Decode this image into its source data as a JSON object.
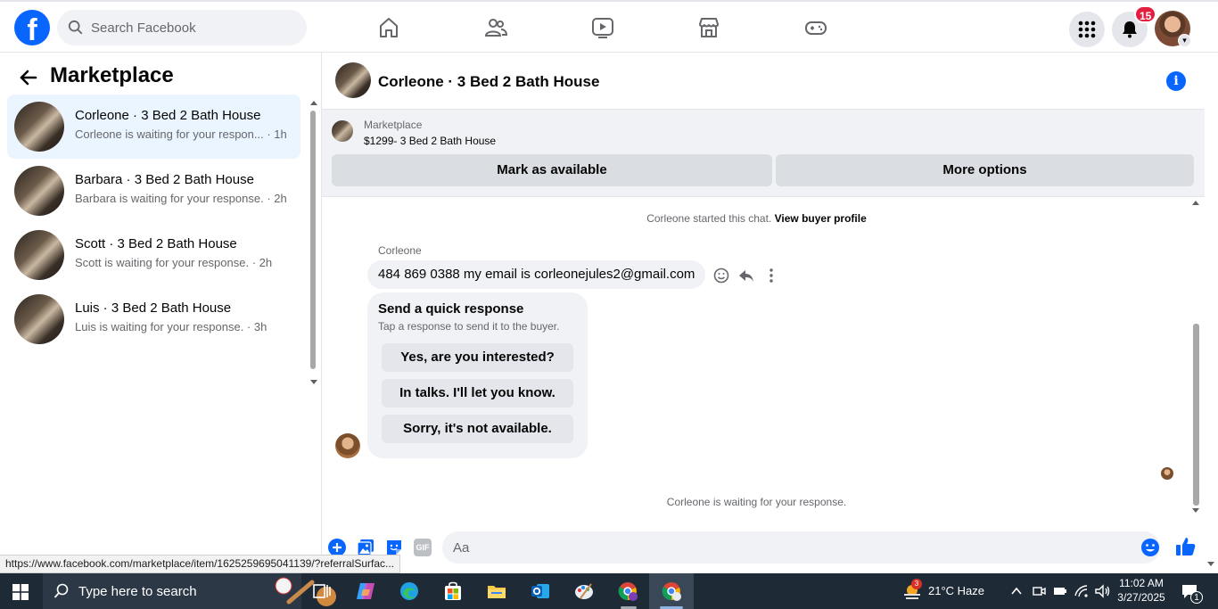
{
  "topbar": {
    "search_placeholder": "Search Facebook",
    "notifications_count": "15"
  },
  "sidebar": {
    "title": "Marketplace",
    "conversations": [
      {
        "title": "Corleone · 3 Bed 2 Bath House",
        "subtitle": "Corleone is waiting for your respon... · 1h",
        "active": true
      },
      {
        "title": "Barbara · 3 Bed 2 Bath House",
        "subtitle": "Barbara is waiting for your response. · 2h",
        "active": false
      },
      {
        "title": "Scott · 3 Bed 2 Bath House",
        "subtitle": "Scott is waiting for your response. · 2h",
        "active": false
      },
      {
        "title": "Luis · 3 Bed 2 Bath House",
        "subtitle": "Luis is waiting for your response. · 3h",
        "active": false
      }
    ]
  },
  "chat": {
    "title": "Corleone · 3 Bed 2 Bath House",
    "listing": {
      "source": "Marketplace",
      "price_title": "$1299- 3 Bed 2 Bath House",
      "mark_available_label": "Mark as available",
      "more_options_label": "More options"
    },
    "started_prefix": "Corleone started this chat.",
    "view_buyer_profile": "View buyer profile",
    "sender_name": "Corleone",
    "message": "484 869 0388  my email is corleonejules2@gmail.com",
    "quick_response": {
      "title": "Send a quick response",
      "subtitle": "Tap a response to send it to the buyer.",
      "options": [
        "Yes, are you interested?",
        "In talks. I'll let you know.",
        "Sorry, it's not available."
      ]
    },
    "waiting_text": "Corleone is waiting for your response.",
    "composer_placeholder": "Aa"
  },
  "status_url": "https://www.facebook.com/marketplace/item/1625259695041139/?referralSurfac...",
  "taskbar": {
    "search_placeholder": "Type here to search",
    "weather_badge": "3",
    "weather": "21°C  Haze",
    "time": "11:02 AM",
    "date": "3/27/2025",
    "notification_count": "1"
  },
  "colors": {
    "brand_blue": "#0866ff",
    "badge_red": "#e41e3f",
    "active_row": "#ebf5ff"
  }
}
